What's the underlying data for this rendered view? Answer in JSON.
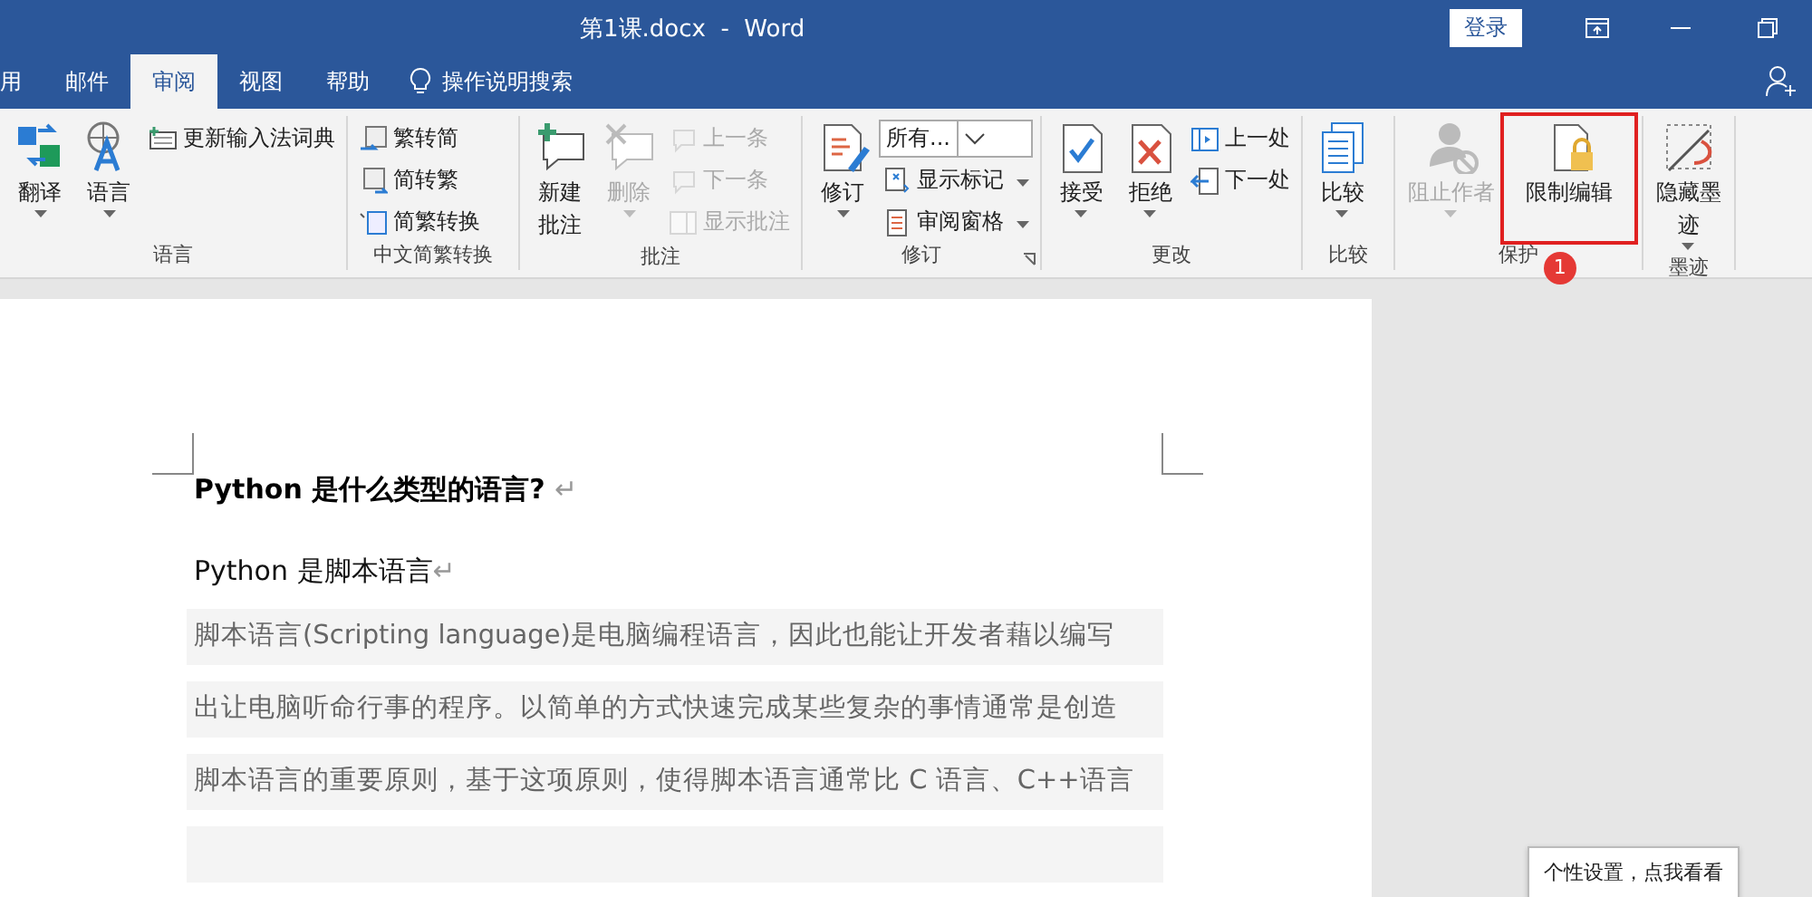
{
  "window": {
    "title": "第1课.docx  -  Word",
    "login": "登录"
  },
  "tabs": [
    {
      "label": "用",
      "selected": false
    },
    {
      "label": "邮件",
      "selected": false
    },
    {
      "label": "审阅",
      "selected": true
    },
    {
      "label": "视图",
      "selected": false
    },
    {
      "label": "帮助",
      "selected": false
    }
  ],
  "search": {
    "placeholder": "操作说明搜索"
  },
  "ribbon": {
    "groups": [
      {
        "label": "语言",
        "items": [
          {
            "kind": "large",
            "label": "翻译",
            "dropdown": true,
            "disabled": false
          },
          {
            "kind": "large",
            "label": "语言",
            "dropdown": true,
            "disabled": false
          },
          {
            "kind": "stack",
            "rows": [
              {
                "label": "更新输入法词典",
                "disabled": false
              }
            ]
          }
        ]
      },
      {
        "label": "中文简繁转换",
        "items": [
          {
            "kind": "stack",
            "rows": [
              {
                "label": "繁转简",
                "disabled": false
              },
              {
                "label": "简转繁",
                "disabled": false
              },
              {
                "label": "简繁转换",
                "disabled": false
              }
            ]
          }
        ]
      },
      {
        "label": "批注",
        "items": [
          {
            "kind": "large",
            "lines": [
              "新建",
              "批注"
            ],
            "dropdown": false,
            "disabled": false
          },
          {
            "kind": "large",
            "label": "删除",
            "dropdown": true,
            "disabled": true
          },
          {
            "kind": "stack",
            "rows": [
              {
                "label": "上一条",
                "disabled": true
              },
              {
                "label": "下一条",
                "disabled": true
              },
              {
                "label": "显示批注",
                "disabled": true
              }
            ]
          }
        ]
      },
      {
        "label": "修订",
        "launcher": true,
        "items": [
          {
            "kind": "large",
            "label": "修订",
            "dropdown": true,
            "disabled": false
          },
          {
            "kind": "stack",
            "rows": [
              {
                "label": "所有...",
                "kind": "combo",
                "disabled": false
              },
              {
                "label": "显示标记",
                "dropdown": true,
                "disabled": false
              },
              {
                "label": "审阅窗格",
                "dropdown": true,
                "disabled": false
              }
            ]
          }
        ]
      },
      {
        "label": "更改",
        "items": [
          {
            "kind": "large",
            "label": "接受",
            "dropdown": true,
            "disabled": false
          },
          {
            "kind": "large",
            "label": "拒绝",
            "dropdown": true,
            "disabled": false
          },
          {
            "kind": "stack",
            "rows": [
              {
                "label": "上一处",
                "disabled": false
              },
              {
                "label": "下一处",
                "disabled": false
              }
            ]
          }
        ]
      },
      {
        "label": "比较",
        "items": [
          {
            "kind": "large",
            "label": "比较",
            "dropdown": true,
            "disabled": false
          }
        ]
      },
      {
        "label": "保护",
        "badge": "1",
        "items": [
          {
            "kind": "large",
            "label": "阻止作者",
            "dropdown": true,
            "disabled": true
          },
          {
            "kind": "large",
            "label": "限制编辑",
            "dropdown": false,
            "disabled": false,
            "highlighted": true
          }
        ]
      },
      {
        "label": "墨迹",
        "items": [
          {
            "kind": "large",
            "lines": [
              "隐藏墨",
              "迹"
            ],
            "dropdown": true,
            "disabled": false
          }
        ]
      }
    ]
  },
  "document": {
    "blocks": [
      {
        "kind": "heading",
        "text": "Python  是什么类型的语言?",
        "mark": "↵"
      },
      {
        "kind": "plain",
        "text": "Python 是脚本语言",
        "mark": "↵"
      },
      {
        "kind": "shaded",
        "text": "脚本语言(Scripting language)是电脑编程语言，因此也能让开发者藉以编写"
      },
      {
        "kind": "shaded",
        "text": "出让电脑听命行事的程序。以简单的方式快速完成某些复杂的事情通常是创造"
      },
      {
        "kind": "shaded",
        "text": "脚本语言的重要原则，基于这项原则，使得脚本语言通常比 C 语言、C++语言"
      },
      {
        "kind": "shaded"
      }
    ]
  },
  "tooltip": "个性设置，点我看看"
}
